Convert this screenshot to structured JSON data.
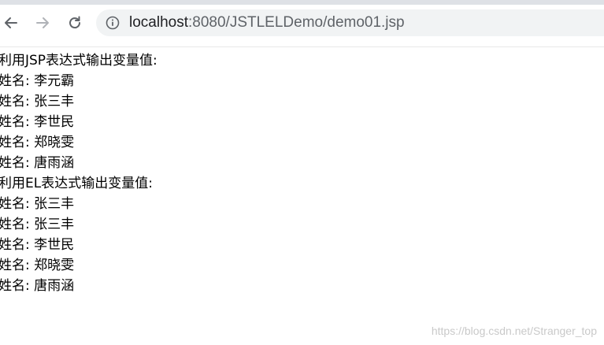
{
  "browser": {
    "url_host": "localhost",
    "url_path": ":8080/JSTLELDemo/demo01.jsp",
    "icons": {
      "back": "arrow-left-icon",
      "forward": "arrow-right-icon",
      "reload": "reload-icon",
      "site_info": "info-icon"
    }
  },
  "content": {
    "jsp_heading": "利用JSP表达式输出变量值:",
    "jsp_names": [
      "姓名: 李元霸",
      "姓名: 张三丰",
      "姓名: 李世民",
      "姓名: 郑晓雯",
      "姓名: 唐雨涵"
    ],
    "el_heading": "利用EL表达式输出变量值:",
    "el_names": [
      "姓名: 张三丰",
      "姓名: 张三丰",
      "姓名: 李世民",
      "姓名: 郑晓雯",
      "姓名: 唐雨涵"
    ]
  },
  "watermark": "https://blog.csdn.net/Stranger_top"
}
